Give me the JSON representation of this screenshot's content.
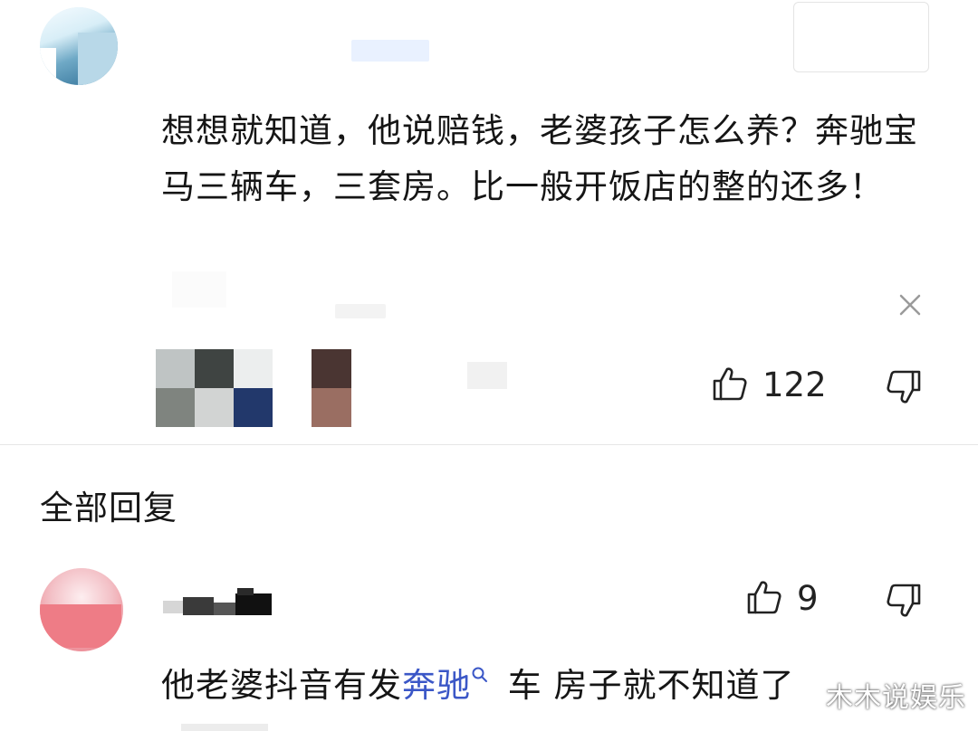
{
  "comment": {
    "text": "想想就知道，他说赔钱，老婆孩子怎么养？奔驰宝马三辆车，三套房。比一般开饭店的整的还多！",
    "likes": "122"
  },
  "section_title": "全部回复",
  "reply": {
    "likes": "9",
    "text_before": "他老婆抖音有发",
    "link_text": "奔驰",
    "text_after": " 车 房子就不知道了"
  },
  "watermark": "木木说娱乐",
  "icons": {
    "close": "close-icon",
    "like": "thumbs-up-icon",
    "dislike": "thumbs-down-icon",
    "search": "search-icon"
  }
}
